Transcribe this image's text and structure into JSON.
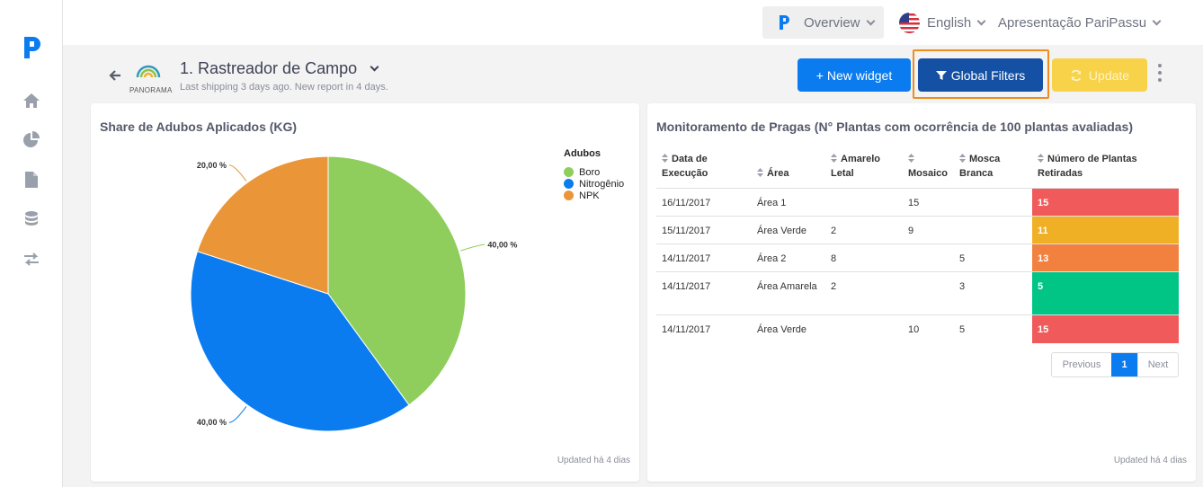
{
  "topbar": {
    "overview_label": "Overview",
    "language_label": "English",
    "account_label": "Apresentação PariPassu"
  },
  "sidebar": {
    "items": [
      {
        "icon": "home-icon"
      },
      {
        "icon": "pie-chart-icon"
      },
      {
        "icon": "file-icon"
      },
      {
        "icon": "database-icon"
      },
      {
        "icon": "exchange-icon"
      }
    ]
  },
  "dashboard": {
    "logo_text": "PANORAMA",
    "title": "1. Rastreador de Campo",
    "subtitle": "Last shipping 3 days ago. New report in 4 days."
  },
  "toolbar": {
    "new_widget_label": "+ New widget",
    "global_filters_label": "Global Filters",
    "update_label": "Update"
  },
  "colors": {
    "primary": "#0a7cf0",
    "filters": "#1450a3",
    "update": "#f8d248",
    "highlight_outline": "#f08c1a"
  },
  "pie_widget": {
    "title": "Share de Adubos Aplicados (KG)",
    "updated": "Updated há 4 dias",
    "legend_title": "Adubos"
  },
  "chart_data": {
    "type": "pie",
    "title": "Share de Adubos Aplicados (KG)",
    "legend_title": "Adubos",
    "legend_position": "top-right",
    "categories": [
      "Boro",
      "Nitrogênio",
      "NPK"
    ],
    "values": [
      40,
      40,
      20
    ],
    "labels": [
      "40,00 %",
      "40,00 %",
      "20,00 %"
    ],
    "colors": [
      "#8fce5c",
      "#0a7cf0",
      "#ea9638"
    ]
  },
  "table_widget": {
    "title": "Monitoramento de Pragas (N° Plantas com ocorrência de 100 plantas avaliadas)",
    "updated": "Updated há 4 dias",
    "headers": [
      "Data de Execução",
      "Área",
      "Amarelo Letal",
      "Mosaico",
      "Mosca Branca",
      "Número de Plantas Retiradas"
    ],
    "rows": [
      {
        "data": "16/11/2017",
        "area": "Área 1",
        "amarelo": "",
        "mosaico": "15",
        "mosca": "",
        "retiradas": "15",
        "color": "#f05a5a"
      },
      {
        "data": "15/11/2017",
        "area": "Área Verde",
        "amarelo": "2",
        "mosaico": "9",
        "mosca": "",
        "retiradas": "11",
        "color": "#f0b025"
      },
      {
        "data": "14/11/2017",
        "area": "Área 2",
        "amarelo": "8",
        "mosaico": "",
        "mosca": "5",
        "retiradas": "13",
        "color": "#f2813f"
      },
      {
        "data": "14/11/2017",
        "area": "Área Amarela",
        "amarelo": "2",
        "mosaico": "",
        "mosca": "3",
        "retiradas": "5",
        "color": "#00c585"
      },
      {
        "data": "14/11/2017",
        "area": "Área Verde",
        "amarelo": "",
        "mosaico": "10",
        "mosca": "5",
        "retiradas": "15",
        "color": "#f05a5a"
      }
    ],
    "pager": {
      "previous": "Previous",
      "current": "1",
      "next": "Next"
    }
  }
}
